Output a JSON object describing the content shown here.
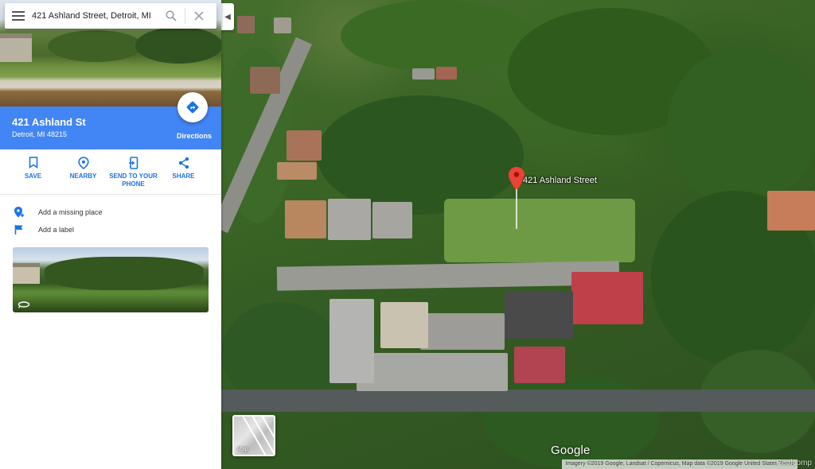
{
  "search": {
    "value": "421 Ashland Street, Detroit, MI"
  },
  "place": {
    "title": "421 Ashland St",
    "address": "Detroit, MI 48215",
    "directions_label": "Directions"
  },
  "actions": [
    {
      "label": "SAVE",
      "icon": "bookmark-icon"
    },
    {
      "label": "NEARBY",
      "icon": "nearby-icon"
    },
    {
      "label": "SEND TO YOUR PHONE",
      "icon": "send-to-phone-icon"
    },
    {
      "label": "SHARE",
      "icon": "share-icon"
    }
  ],
  "list": {
    "add_missing_place": "Add a missing place",
    "add_label": "Add a label"
  },
  "map": {
    "pin_label": "421 Ashland Street",
    "toggle_label": "Map",
    "logo": "Google",
    "attribution": "Imagery ©2019 Google, Landsat / Copernicus, Map data ©2019 Google   United States   Terms",
    "watermark": "Realcomp"
  },
  "colors": {
    "accent": "#4285f4",
    "pin": "#ea4335",
    "link": "#1a73e8"
  }
}
